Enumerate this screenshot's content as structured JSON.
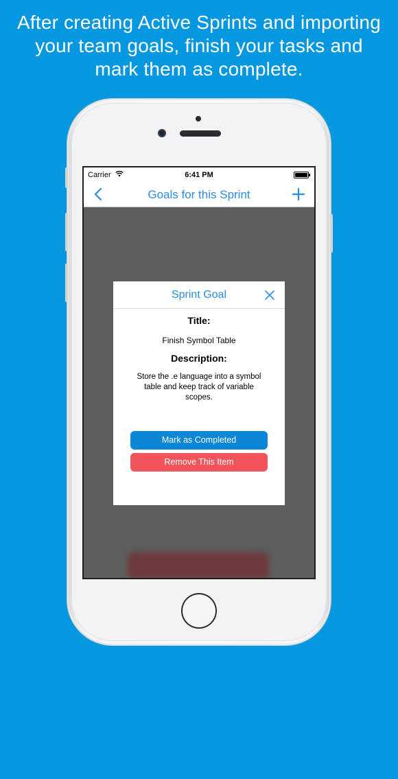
{
  "headline": "After creating Active Sprints and importing your team goals, finish your tasks and mark them as complete.",
  "status_bar": {
    "carrier": "Carrier",
    "time": "6:41 PM"
  },
  "nav": {
    "title": "Goals for this Sprint",
    "back_icon": "chevron-left-icon",
    "add_icon": "plus-icon"
  },
  "modal": {
    "title": "Sprint Goal",
    "close_icon": "close-icon",
    "title_label": "Title:",
    "title_value": "Finish Symbol Table",
    "description_label": "Description:",
    "description_value": "Store the .e language into a symbol table and keep track of variable scopes.",
    "complete_button": "Mark as Completed",
    "remove_button": "Remove This Item"
  },
  "colors": {
    "background": "#0598e0",
    "accent": "#2a8ce0",
    "complete": "#0c87d6",
    "remove": "#f2545b"
  }
}
